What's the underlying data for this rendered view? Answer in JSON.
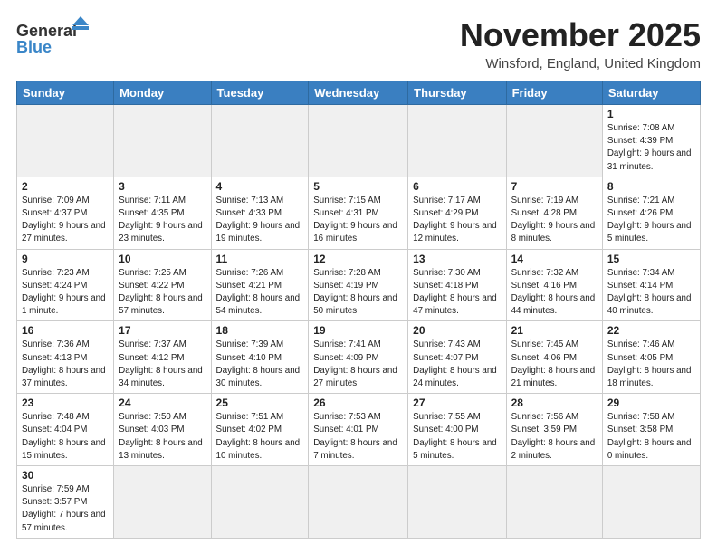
{
  "header": {
    "logo_general": "General",
    "logo_blue": "Blue",
    "title": "November 2025",
    "subtitle": "Winsford, England, United Kingdom"
  },
  "weekdays": [
    "Sunday",
    "Monday",
    "Tuesday",
    "Wednesday",
    "Thursday",
    "Friday",
    "Saturday"
  ],
  "weeks": [
    [
      {
        "day": "",
        "info": ""
      },
      {
        "day": "",
        "info": ""
      },
      {
        "day": "",
        "info": ""
      },
      {
        "day": "",
        "info": ""
      },
      {
        "day": "",
        "info": ""
      },
      {
        "day": "",
        "info": ""
      },
      {
        "day": "1",
        "info": "Sunrise: 7:08 AM\nSunset: 4:39 PM\nDaylight: 9 hours\nand 31 minutes."
      }
    ],
    [
      {
        "day": "2",
        "info": "Sunrise: 7:09 AM\nSunset: 4:37 PM\nDaylight: 9 hours\nand 27 minutes."
      },
      {
        "day": "3",
        "info": "Sunrise: 7:11 AM\nSunset: 4:35 PM\nDaylight: 9 hours\nand 23 minutes."
      },
      {
        "day": "4",
        "info": "Sunrise: 7:13 AM\nSunset: 4:33 PM\nDaylight: 9 hours\nand 19 minutes."
      },
      {
        "day": "5",
        "info": "Sunrise: 7:15 AM\nSunset: 4:31 PM\nDaylight: 9 hours\nand 16 minutes."
      },
      {
        "day": "6",
        "info": "Sunrise: 7:17 AM\nSunset: 4:29 PM\nDaylight: 9 hours\nand 12 minutes."
      },
      {
        "day": "7",
        "info": "Sunrise: 7:19 AM\nSunset: 4:28 PM\nDaylight: 9 hours\nand 8 minutes."
      },
      {
        "day": "8",
        "info": "Sunrise: 7:21 AM\nSunset: 4:26 PM\nDaylight: 9 hours\nand 5 minutes."
      }
    ],
    [
      {
        "day": "9",
        "info": "Sunrise: 7:23 AM\nSunset: 4:24 PM\nDaylight: 9 hours\nand 1 minute."
      },
      {
        "day": "10",
        "info": "Sunrise: 7:25 AM\nSunset: 4:22 PM\nDaylight: 8 hours\nand 57 minutes."
      },
      {
        "day": "11",
        "info": "Sunrise: 7:26 AM\nSunset: 4:21 PM\nDaylight: 8 hours\nand 54 minutes."
      },
      {
        "day": "12",
        "info": "Sunrise: 7:28 AM\nSunset: 4:19 PM\nDaylight: 8 hours\nand 50 minutes."
      },
      {
        "day": "13",
        "info": "Sunrise: 7:30 AM\nSunset: 4:18 PM\nDaylight: 8 hours\nand 47 minutes."
      },
      {
        "day": "14",
        "info": "Sunrise: 7:32 AM\nSunset: 4:16 PM\nDaylight: 8 hours\nand 44 minutes."
      },
      {
        "day": "15",
        "info": "Sunrise: 7:34 AM\nSunset: 4:14 PM\nDaylight: 8 hours\nand 40 minutes."
      }
    ],
    [
      {
        "day": "16",
        "info": "Sunrise: 7:36 AM\nSunset: 4:13 PM\nDaylight: 8 hours\nand 37 minutes."
      },
      {
        "day": "17",
        "info": "Sunrise: 7:37 AM\nSunset: 4:12 PM\nDaylight: 8 hours\nand 34 minutes."
      },
      {
        "day": "18",
        "info": "Sunrise: 7:39 AM\nSunset: 4:10 PM\nDaylight: 8 hours\nand 30 minutes."
      },
      {
        "day": "19",
        "info": "Sunrise: 7:41 AM\nSunset: 4:09 PM\nDaylight: 8 hours\nand 27 minutes."
      },
      {
        "day": "20",
        "info": "Sunrise: 7:43 AM\nSunset: 4:07 PM\nDaylight: 8 hours\nand 24 minutes."
      },
      {
        "day": "21",
        "info": "Sunrise: 7:45 AM\nSunset: 4:06 PM\nDaylight: 8 hours\nand 21 minutes."
      },
      {
        "day": "22",
        "info": "Sunrise: 7:46 AM\nSunset: 4:05 PM\nDaylight: 8 hours\nand 18 minutes."
      }
    ],
    [
      {
        "day": "23",
        "info": "Sunrise: 7:48 AM\nSunset: 4:04 PM\nDaylight: 8 hours\nand 15 minutes."
      },
      {
        "day": "24",
        "info": "Sunrise: 7:50 AM\nSunset: 4:03 PM\nDaylight: 8 hours\nand 13 minutes."
      },
      {
        "day": "25",
        "info": "Sunrise: 7:51 AM\nSunset: 4:02 PM\nDaylight: 8 hours\nand 10 minutes."
      },
      {
        "day": "26",
        "info": "Sunrise: 7:53 AM\nSunset: 4:01 PM\nDaylight: 8 hours\nand 7 minutes."
      },
      {
        "day": "27",
        "info": "Sunrise: 7:55 AM\nSunset: 4:00 PM\nDaylight: 8 hours\nand 5 minutes."
      },
      {
        "day": "28",
        "info": "Sunrise: 7:56 AM\nSunset: 3:59 PM\nDaylight: 8 hours\nand 2 minutes."
      },
      {
        "day": "29",
        "info": "Sunrise: 7:58 AM\nSunset: 3:58 PM\nDaylight: 8 hours\nand 0 minutes."
      }
    ],
    [
      {
        "day": "30",
        "info": "Sunrise: 7:59 AM\nSunset: 3:57 PM\nDaylight: 7 hours\nand 57 minutes."
      },
      {
        "day": "",
        "info": ""
      },
      {
        "day": "",
        "info": ""
      },
      {
        "day": "",
        "info": ""
      },
      {
        "day": "",
        "info": ""
      },
      {
        "day": "",
        "info": ""
      },
      {
        "day": "",
        "info": ""
      }
    ]
  ]
}
